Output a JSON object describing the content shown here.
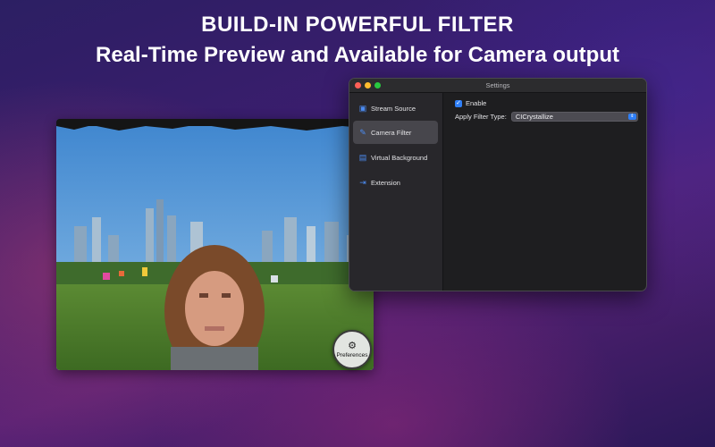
{
  "headline": {
    "line1": "BUILD-IN POWERFUL FILTER",
    "line2": "Real-Time Preview and Available for Camera output"
  },
  "preview": {
    "button_label": "Preferences",
    "button_icon": "camera-gear-icon"
  },
  "window": {
    "title": "Settings",
    "sidebar": {
      "items": [
        {
          "label": "Stream Source",
          "icon": "video-camera-icon",
          "active": false
        },
        {
          "label": "Camera Filter",
          "icon": "wand-icon",
          "active": true
        },
        {
          "label": "Virtual Background",
          "icon": "photo-icon",
          "active": false
        },
        {
          "label": "Extension",
          "icon": "extension-icon",
          "active": false
        }
      ]
    },
    "content": {
      "enable_label": "Enable",
      "enable_checked": true,
      "filter_label": "Apply Filter Type:",
      "filter_value": "CICrystallize"
    }
  },
  "colors": {
    "accent": "#2f7ff7",
    "window_bg": "#1e1e20",
    "sidebar_bg": "#28272b",
    "traffic_red": "#ff5f57",
    "traffic_yellow": "#febc2e",
    "traffic_green": "#28c840"
  }
}
